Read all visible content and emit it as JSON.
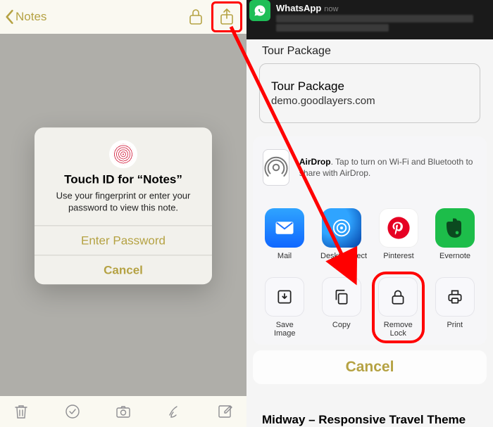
{
  "left": {
    "back_label": "Notes",
    "alert": {
      "title": "Touch ID for “Notes”",
      "message": "Use your fingerprint or enter your password to view this note.",
      "enter_password": "Enter Password",
      "cancel": "Cancel"
    }
  },
  "right": {
    "notification": {
      "app": "WhatsApp",
      "time": "now"
    },
    "page": {
      "heading": "Tour Package",
      "card_title": "Tour Package",
      "card_subtitle": "demo.goodlayers.com",
      "bottom_cut": "Midway – Responsive Travel Theme"
    },
    "sheet": {
      "airdrop_label": "AirDrop",
      "airdrop_text": ". Tap to turn on Wi-Fi and Bluetooth to share with AirDrop.",
      "apps": [
        "Mail",
        "DeskConnect",
        "Pinterest",
        "Evernote"
      ],
      "actions": [
        "Save Image",
        "Copy",
        "Remove Lock",
        "Print"
      ],
      "cancel": "Cancel"
    }
  }
}
